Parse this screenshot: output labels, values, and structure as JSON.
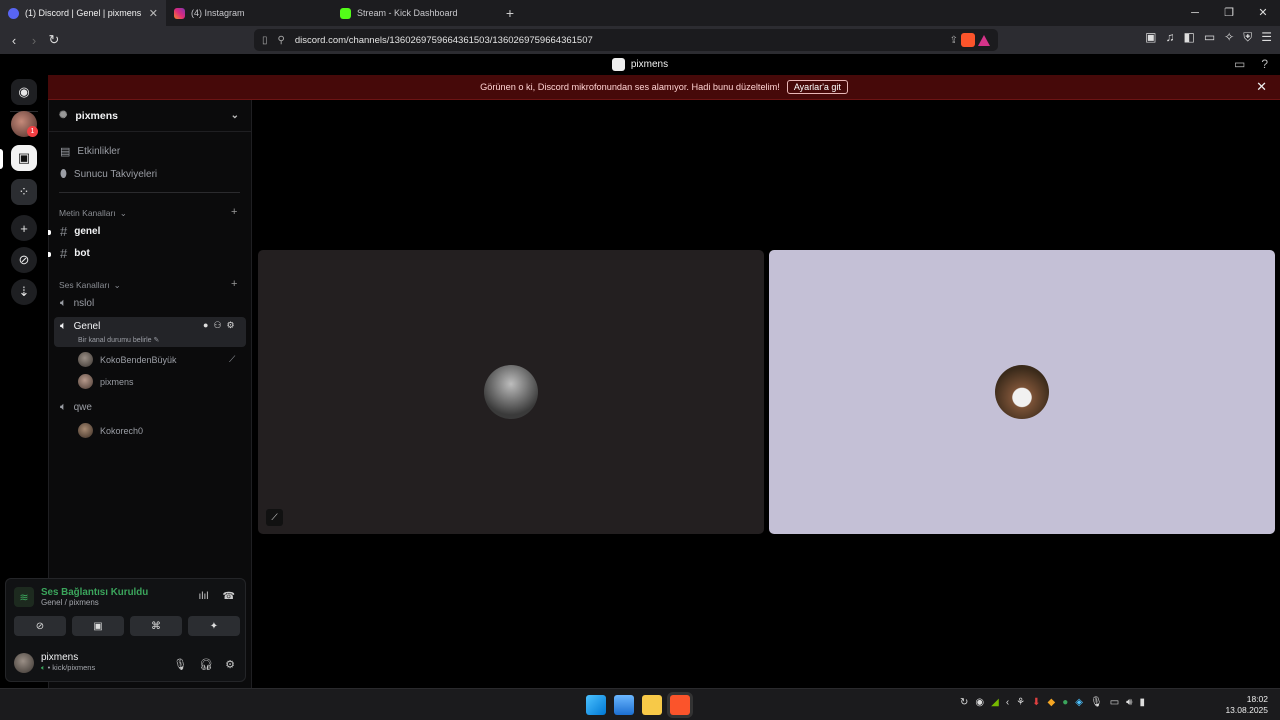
{
  "browser": {
    "tabs": [
      {
        "title": "(1) Discord | Genel | pixmens",
        "favicon": "discord-icon",
        "active": true
      },
      {
        "title": "(4) Instagram",
        "favicon": "instagram-icon",
        "active": false
      },
      {
        "title": "Stream - Kick Dashboard",
        "favicon": "kick-icon",
        "active": false
      }
    ],
    "url": "discord.com/channels/1360269759664361503/1360269759664361507"
  },
  "discord": {
    "window_title": "pixmens",
    "banner": {
      "message": "Görünen o ki, Discord mikrofonundan ses alamıyor. Hadi bunu düzeltelim!",
      "button": "Ayarlar'a git"
    },
    "rail_badge": "1",
    "server": {
      "name": "pixmens",
      "menu": [
        {
          "label": "Etkinlikler",
          "icon": "calendar-icon"
        },
        {
          "label": "Sunucu Takviyeleri",
          "icon": "boost-icon"
        }
      ],
      "text_category": "Metin Kanalları",
      "text_channels": [
        "genel",
        "bot"
      ],
      "voice_category": "Ses Kanalları",
      "voice_channels": [
        {
          "name": "nslol",
          "users": []
        },
        {
          "name": "Genel",
          "status": "Bir kanal durumu belirle",
          "users": [
            "KokoBendenBüyük",
            "pixmens"
          ]
        },
        {
          "name": "qwe",
          "users": [
            "Kokorech0"
          ]
        }
      ]
    },
    "voice_panel": {
      "status": "Ses Bağlantısı Kuruldu",
      "location": "Genel / pixmens"
    },
    "user": {
      "name": "pixmens",
      "status": "• kick/pixmens"
    },
    "colors": {
      "banner_bg": "#460909",
      "connected_green": "#3ba55c",
      "tile_left": "#231f20",
      "tile_right": "#c4c0d6"
    }
  },
  "taskbar": {
    "time": "18:02",
    "date": "13.08.2025"
  }
}
